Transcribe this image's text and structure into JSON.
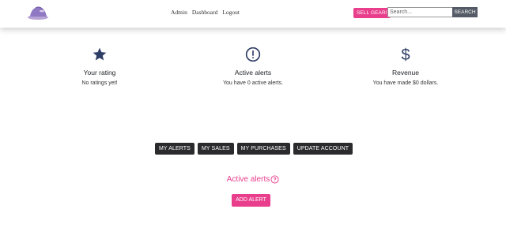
{
  "navbar": {
    "links": [
      {
        "label": "Admin"
      },
      {
        "label": "Dashboard"
      },
      {
        "label": "Logout"
      }
    ],
    "sell_button": "SELL GEAR!",
    "search": {
      "placeholder": "Search...",
      "value": ""
    },
    "search_button": "SEARCH"
  },
  "stats": [
    {
      "icon": "star-icon",
      "title": "Your rating",
      "text": "No ratings yet!"
    },
    {
      "icon": "exclamation-circle-icon",
      "title": "Active alerts",
      "text": "You have 0 active alerts."
    },
    {
      "icon": "dollar-icon",
      "title": "Revenue",
      "text": "You have made $0 dollars."
    }
  ],
  "tabs": [
    {
      "label": "MY ALERTS"
    },
    {
      "label": "MY SALES"
    },
    {
      "label": "MY PURCHASES"
    },
    {
      "label": "UPDATE ACCOUNT"
    }
  ],
  "alerts_section": {
    "heading": "Active alerts",
    "add_button": "ADD ALERT"
  },
  "colors": {
    "accent": "#e83e8c",
    "icon": "#2f3e66",
    "dark_button": "#2b2b2e"
  }
}
